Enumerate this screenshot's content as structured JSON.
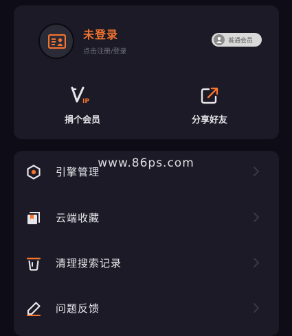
{
  "profile": {
    "title": "未登录",
    "subtitle": "点击注册/登录",
    "badge_label": "普通会员"
  },
  "actions": [
    {
      "label": "捐个会员",
      "icon": "vip-icon"
    },
    {
      "label": "分享好友",
      "icon": "share-icon"
    }
  ],
  "menu": {
    "items": [
      {
        "label": "引擎管理",
        "icon": "hexagon-icon"
      },
      {
        "label": "云端收藏",
        "icon": "bookmark-icon"
      },
      {
        "label": "清理搜索记录",
        "icon": "trash-icon"
      },
      {
        "label": "问题反馈",
        "icon": "pencil-icon"
      }
    ]
  },
  "watermark": "www.86ps.com",
  "colors": {
    "background": "#0e0d17",
    "card": "#1b1a26",
    "accent": "#f4732d",
    "text": "#e9e9ee",
    "muted": "#6f6e7c"
  }
}
